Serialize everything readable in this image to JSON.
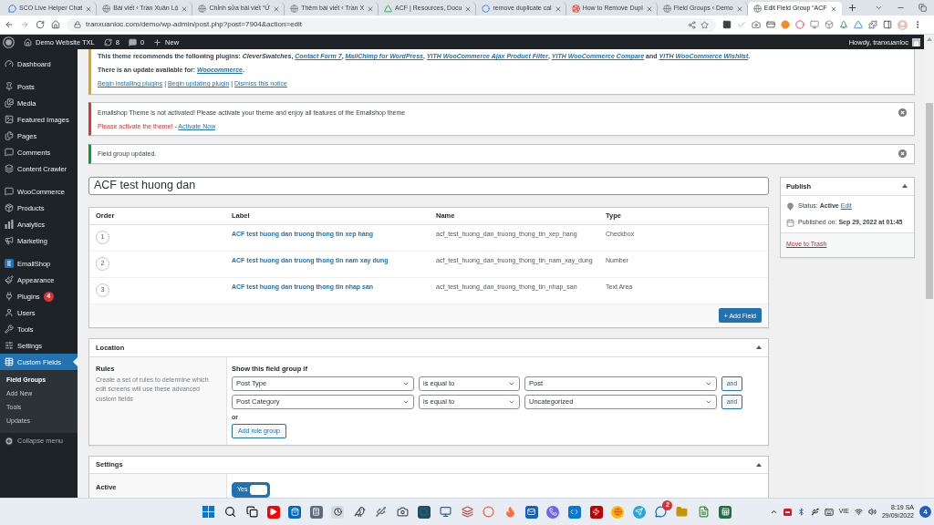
{
  "browser": {
    "tabs": [
      {
        "title": "SCO Live Helper Chat",
        "selected": false
      },
      {
        "title": "Bài viết ‹ Trần Xuân Lộ",
        "selected": false
      },
      {
        "title": "Chỉnh sửa bài viết “Ứ",
        "selected": false
      },
      {
        "title": "Thêm bài viết ‹ Trần X",
        "selected": false
      },
      {
        "title": "ACF | Resources, Docu",
        "selected": false
      },
      {
        "title": "remove duplicate cal",
        "selected": false
      },
      {
        "title": "How to Remove Dupl",
        "selected": false
      },
      {
        "title": "Field Groups ‹ Demo",
        "selected": false
      },
      {
        "title": "Edit Field Group “ACF",
        "selected": true
      }
    ],
    "url": "tranxuanloc.com/demo/wp-admin/post.php?post=7904&action=edit"
  },
  "admin_bar": {
    "site": "Demo Website TXL",
    "updates": "8",
    "comments": "0",
    "new": "New",
    "greeting": "Howdy, tranxuanloc"
  },
  "sidebar": {
    "groups": [
      {
        "items": [
          {
            "label": "Dashboard",
            "selected": false
          }
        ]
      },
      {
        "items": [
          {
            "label": "Posts",
            "selected": false
          },
          {
            "label": "Media",
            "selected": false
          },
          {
            "label": "Featured Images",
            "selected": false
          },
          {
            "label": "Pages",
            "selected": false
          },
          {
            "label": "Comments",
            "selected": false
          },
          {
            "label": "Content Crawler",
            "selected": false
          }
        ]
      },
      {
        "items": [
          {
            "label": "WooCommerce",
            "selected": false
          },
          {
            "label": "Products",
            "selected": false
          },
          {
            "label": "Analytics",
            "selected": false
          },
          {
            "label": "Marketing",
            "selected": false
          }
        ]
      },
      {
        "items": [
          {
            "label": "EmallShop",
            "selected": false
          },
          {
            "label": "Appearance",
            "selected": false
          },
          {
            "label": "Plugins",
            "selected": false,
            "badge": "4"
          },
          {
            "label": "Users",
            "selected": false
          },
          {
            "label": "Tools",
            "selected": false
          },
          {
            "label": "Settings",
            "selected": false
          },
          {
            "label": "Custom Fields",
            "selected": true,
            "children": [
              {
                "label": "Field Groups",
                "selected": true
              },
              {
                "label": "Add New",
                "selected": false
              },
              {
                "label": "Tools",
                "selected": false
              },
              {
                "label": "Updates",
                "selected": false
              }
            ]
          }
        ]
      }
    ],
    "collapse": "Collapse menu"
  },
  "notices": [
    {
      "kind": "warning",
      "dismissible": false,
      "lines": [
        {
          "strong": true,
          "parts": [
            {
              "text": "This theme recommends the following plugins: ",
              "kind": "text"
            },
            {
              "text": "CleverSwatches",
              "kind": "em"
            },
            {
              "text": ", ",
              "kind": "text"
            },
            {
              "text": "Contact Form 7",
              "kind": "em-link"
            },
            {
              "text": ", ",
              "kind": "text"
            },
            {
              "text": "MailChimp for WordPress",
              "kind": "em-link"
            },
            {
              "text": ", ",
              "kind": "text"
            },
            {
              "text": "YITH WooCommerce Ajax Product Filter",
              "kind": "em-link"
            },
            {
              "text": ", ",
              "kind": "text"
            },
            {
              "text": "YITH WooCommerce Compare",
              "kind": "em-link"
            },
            {
              "text": " and ",
              "kind": "text"
            },
            {
              "text": "YITH WooCommerce Wishlist",
              "kind": "em-link"
            },
            {
              "text": ".",
              "kind": "text"
            }
          ]
        },
        {
          "strong": true,
          "parts": [
            {
              "text": "There is an update available for: ",
              "kind": "text"
            },
            {
              "text": "Woocommerce",
              "kind": "em-link"
            },
            {
              "text": ".",
              "kind": "text"
            }
          ]
        },
        {
          "strong": false,
          "parts": [
            {
              "text": "Begin installing plugins",
              "kind": "link"
            },
            {
              "text": " | ",
              "kind": "text"
            },
            {
              "text": "Begin updating plugin",
              "kind": "link"
            },
            {
              "text": " | ",
              "kind": "text"
            },
            {
              "text": "Dismiss this notice",
              "kind": "link"
            }
          ]
        }
      ]
    },
    {
      "kind": "error",
      "dismissible": true,
      "lines": [
        {
          "strong": false,
          "parts": [
            {
              "text": "Emallshop Theme is not activated! Please activate your theme and enjoy all features of the Emallshop theme",
              "kind": "text"
            }
          ]
        },
        {
          "strong": false,
          "parts": [
            {
              "text": "Please activate the theme!",
              "kind": "alert"
            },
            {
              "text": " - ",
              "kind": "text"
            },
            {
              "text": "Activate Now",
              "kind": "link"
            }
          ]
        }
      ]
    },
    {
      "kind": "success",
      "dismissible": true,
      "lines": [
        {
          "strong": false,
          "parts": [
            {
              "text": "Field group updated.",
              "kind": "text"
            }
          ]
        }
      ]
    }
  ],
  "title": {
    "value": "ACF test huong dan"
  },
  "fields": {
    "columns": [
      "Order",
      "Label",
      "Name",
      "Type"
    ],
    "rows": [
      {
        "order": "1",
        "label": "ACF test huong dan truong thong tin xep hang",
        "name": "acf_test_huong_dan_truong_thong_tin_xep_hang",
        "type": "Checkbox"
      },
      {
        "order": "2",
        "label": "ACF test huong dan truong thong tin nam xay dung",
        "name": "acf_test_huong_dan_truong_thong_tin_nam_xay_dung",
        "type": "Number"
      },
      {
        "order": "3",
        "label": "ACF test huong dan truong thong tin nhap san",
        "name": "acf_test_huong_dan_truong_thong_tin_nhap_san",
        "type": "Text Area"
      }
    ],
    "add_button": "+ Add Field"
  },
  "location": {
    "title": "Location",
    "expanded": true,
    "rules_label": "Rules",
    "rules_help": "Create a set of rules to determine which edit screens will use these advanced custom fields",
    "intro": "Show this field group if",
    "rules": [
      {
        "param": "Post Type",
        "operator": "is equal to",
        "value": "Post",
        "and": "and"
      },
      {
        "param": "Post Category",
        "operator": "is equal to",
        "value": "Uncategorized",
        "and": "and"
      }
    ],
    "or": "or",
    "add_group": "Add rule group"
  },
  "settings": {
    "title": "Settings",
    "expanded": true,
    "rows": [
      {
        "label": "Active",
        "toggle": {
          "label": "Yes",
          "on": true
        }
      }
    ]
  },
  "publish": {
    "title": "Publish",
    "expanded": true,
    "status_label": "Status:",
    "status": "Active",
    "status_link": "Edit",
    "date_label": "Published on:",
    "date": "Sep 29, 2022 at 01:45",
    "trash": "Move to Trash"
  },
  "taskbar": {
    "app_badge": "2",
    "language": "VIE",
    "time": "8:19 SA",
    "date": "29/09/2022",
    "notifications": "4"
  }
}
